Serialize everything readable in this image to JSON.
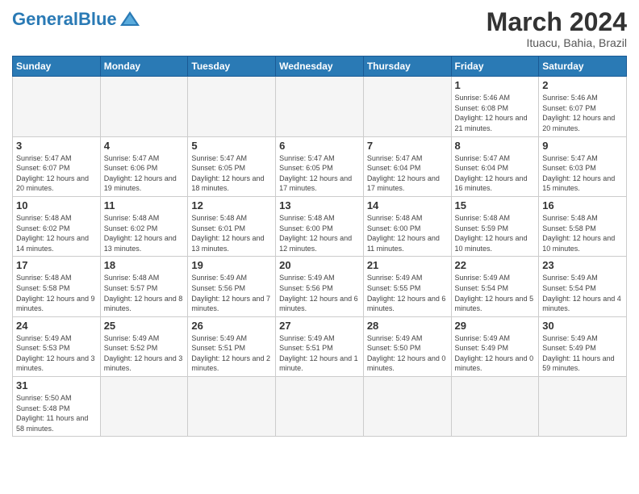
{
  "header": {
    "logo_text_general": "General",
    "logo_text_blue": "Blue",
    "month_year": "March 2024",
    "location": "Ituacu, Bahia, Brazil"
  },
  "days_of_week": [
    "Sunday",
    "Monday",
    "Tuesday",
    "Wednesday",
    "Thursday",
    "Friday",
    "Saturday"
  ],
  "weeks": [
    [
      {
        "day": "",
        "info": ""
      },
      {
        "day": "",
        "info": ""
      },
      {
        "day": "",
        "info": ""
      },
      {
        "day": "",
        "info": ""
      },
      {
        "day": "",
        "info": ""
      },
      {
        "day": "1",
        "info": "Sunrise: 5:46 AM\nSunset: 6:08 PM\nDaylight: 12 hours\nand 21 minutes."
      },
      {
        "day": "2",
        "info": "Sunrise: 5:46 AM\nSunset: 6:07 PM\nDaylight: 12 hours\nand 20 minutes."
      }
    ],
    [
      {
        "day": "3",
        "info": "Sunrise: 5:47 AM\nSunset: 6:07 PM\nDaylight: 12 hours\nand 20 minutes."
      },
      {
        "day": "4",
        "info": "Sunrise: 5:47 AM\nSunset: 6:06 PM\nDaylight: 12 hours\nand 19 minutes."
      },
      {
        "day": "5",
        "info": "Sunrise: 5:47 AM\nSunset: 6:05 PM\nDaylight: 12 hours\nand 18 minutes."
      },
      {
        "day": "6",
        "info": "Sunrise: 5:47 AM\nSunset: 6:05 PM\nDaylight: 12 hours\nand 17 minutes."
      },
      {
        "day": "7",
        "info": "Sunrise: 5:47 AM\nSunset: 6:04 PM\nDaylight: 12 hours\nand 17 minutes."
      },
      {
        "day": "8",
        "info": "Sunrise: 5:47 AM\nSunset: 6:04 PM\nDaylight: 12 hours\nand 16 minutes."
      },
      {
        "day": "9",
        "info": "Sunrise: 5:47 AM\nSunset: 6:03 PM\nDaylight: 12 hours\nand 15 minutes."
      }
    ],
    [
      {
        "day": "10",
        "info": "Sunrise: 5:48 AM\nSunset: 6:02 PM\nDaylight: 12 hours\nand 14 minutes."
      },
      {
        "day": "11",
        "info": "Sunrise: 5:48 AM\nSunset: 6:02 PM\nDaylight: 12 hours\nand 13 minutes."
      },
      {
        "day": "12",
        "info": "Sunrise: 5:48 AM\nSunset: 6:01 PM\nDaylight: 12 hours\nand 13 minutes."
      },
      {
        "day": "13",
        "info": "Sunrise: 5:48 AM\nSunset: 6:00 PM\nDaylight: 12 hours\nand 12 minutes."
      },
      {
        "day": "14",
        "info": "Sunrise: 5:48 AM\nSunset: 6:00 PM\nDaylight: 12 hours\nand 11 minutes."
      },
      {
        "day": "15",
        "info": "Sunrise: 5:48 AM\nSunset: 5:59 PM\nDaylight: 12 hours\nand 10 minutes."
      },
      {
        "day": "16",
        "info": "Sunrise: 5:48 AM\nSunset: 5:58 PM\nDaylight: 12 hours\nand 10 minutes."
      }
    ],
    [
      {
        "day": "17",
        "info": "Sunrise: 5:48 AM\nSunset: 5:58 PM\nDaylight: 12 hours\nand 9 minutes."
      },
      {
        "day": "18",
        "info": "Sunrise: 5:48 AM\nSunset: 5:57 PM\nDaylight: 12 hours\nand 8 minutes."
      },
      {
        "day": "19",
        "info": "Sunrise: 5:49 AM\nSunset: 5:56 PM\nDaylight: 12 hours\nand 7 minutes."
      },
      {
        "day": "20",
        "info": "Sunrise: 5:49 AM\nSunset: 5:56 PM\nDaylight: 12 hours\nand 6 minutes."
      },
      {
        "day": "21",
        "info": "Sunrise: 5:49 AM\nSunset: 5:55 PM\nDaylight: 12 hours\nand 6 minutes."
      },
      {
        "day": "22",
        "info": "Sunrise: 5:49 AM\nSunset: 5:54 PM\nDaylight: 12 hours\nand 5 minutes."
      },
      {
        "day": "23",
        "info": "Sunrise: 5:49 AM\nSunset: 5:54 PM\nDaylight: 12 hours\nand 4 minutes."
      }
    ],
    [
      {
        "day": "24",
        "info": "Sunrise: 5:49 AM\nSunset: 5:53 PM\nDaylight: 12 hours\nand 3 minutes."
      },
      {
        "day": "25",
        "info": "Sunrise: 5:49 AM\nSunset: 5:52 PM\nDaylight: 12 hours\nand 3 minutes."
      },
      {
        "day": "26",
        "info": "Sunrise: 5:49 AM\nSunset: 5:51 PM\nDaylight: 12 hours\nand 2 minutes."
      },
      {
        "day": "27",
        "info": "Sunrise: 5:49 AM\nSunset: 5:51 PM\nDaylight: 12 hours\nand 1 minute."
      },
      {
        "day": "28",
        "info": "Sunrise: 5:49 AM\nSunset: 5:50 PM\nDaylight: 12 hours\nand 0 minutes."
      },
      {
        "day": "29",
        "info": "Sunrise: 5:49 AM\nSunset: 5:49 PM\nDaylight: 12 hours\nand 0 minutes."
      },
      {
        "day": "30",
        "info": "Sunrise: 5:49 AM\nSunset: 5:49 PM\nDaylight: 11 hours\nand 59 minutes."
      }
    ],
    [
      {
        "day": "31",
        "info": "Sunrise: 5:50 AM\nSunset: 5:48 PM\nDaylight: 11 hours\nand 58 minutes."
      },
      {
        "day": "",
        "info": ""
      },
      {
        "day": "",
        "info": ""
      },
      {
        "day": "",
        "info": ""
      },
      {
        "day": "",
        "info": ""
      },
      {
        "day": "",
        "info": ""
      },
      {
        "day": "",
        "info": ""
      }
    ]
  ]
}
